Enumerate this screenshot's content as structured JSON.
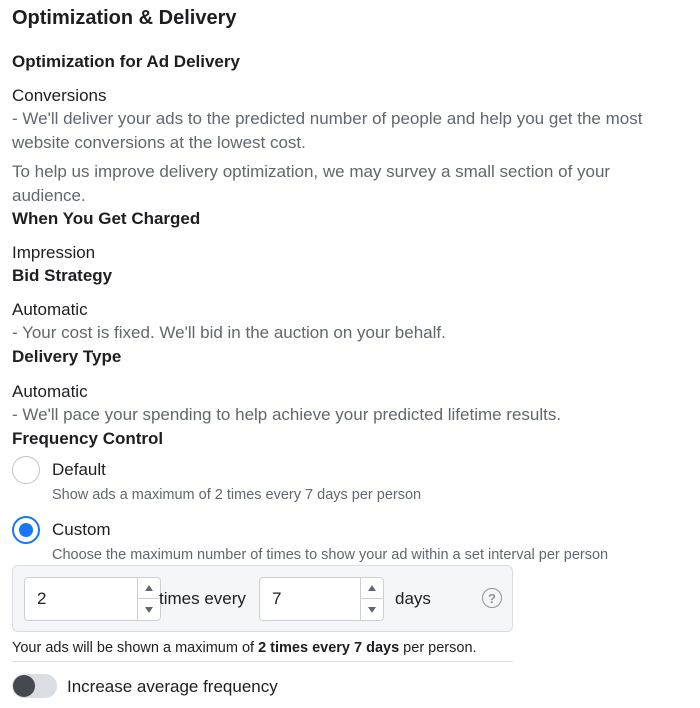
{
  "section": {
    "title": "Optimization & Delivery"
  },
  "optimization": {
    "label": "Optimization for Ad Delivery",
    "value": "Conversions",
    "description": "- We'll deliver your ads to the predicted number of people and help you get the most website conversions at the lowest cost.",
    "survey_note": "To help us improve delivery optimization, we may survey a small section of your audience."
  },
  "charged": {
    "label": "When You Get Charged",
    "value": "Impression"
  },
  "bid_strategy": {
    "label": "Bid Strategy",
    "value": "Automatic",
    "description": "- Your cost is fixed. We'll bid in the auction on your behalf."
  },
  "delivery_type": {
    "label": "Delivery Type",
    "value": "Automatic",
    "description": "- We'll pace your spending to help achieve your predicted lifetime results."
  },
  "frequency": {
    "label": "Frequency Control",
    "selected": "custom",
    "options": [
      {
        "label": "Default",
        "description": "Show ads a maximum of 2 times every 7 days per person"
      },
      {
        "label": "Custom",
        "description": "Choose the maximum number of times to show your ad within a set interval per person"
      }
    ],
    "times_value": "2",
    "times_label": "times every",
    "days_value": "7",
    "days_label": "days",
    "help_icon": "question-mark-icon",
    "summary": {
      "prefix": "Your ads will be shown a maximum of ",
      "bold": "2 times every 7 days",
      "suffix": " per person."
    }
  },
  "increase_frequency": {
    "label": "Increase average frequency",
    "enabled": false
  },
  "colors": {
    "accent": "#1877f2",
    "text": "#1c1e21",
    "secondary_text": "#606770"
  }
}
